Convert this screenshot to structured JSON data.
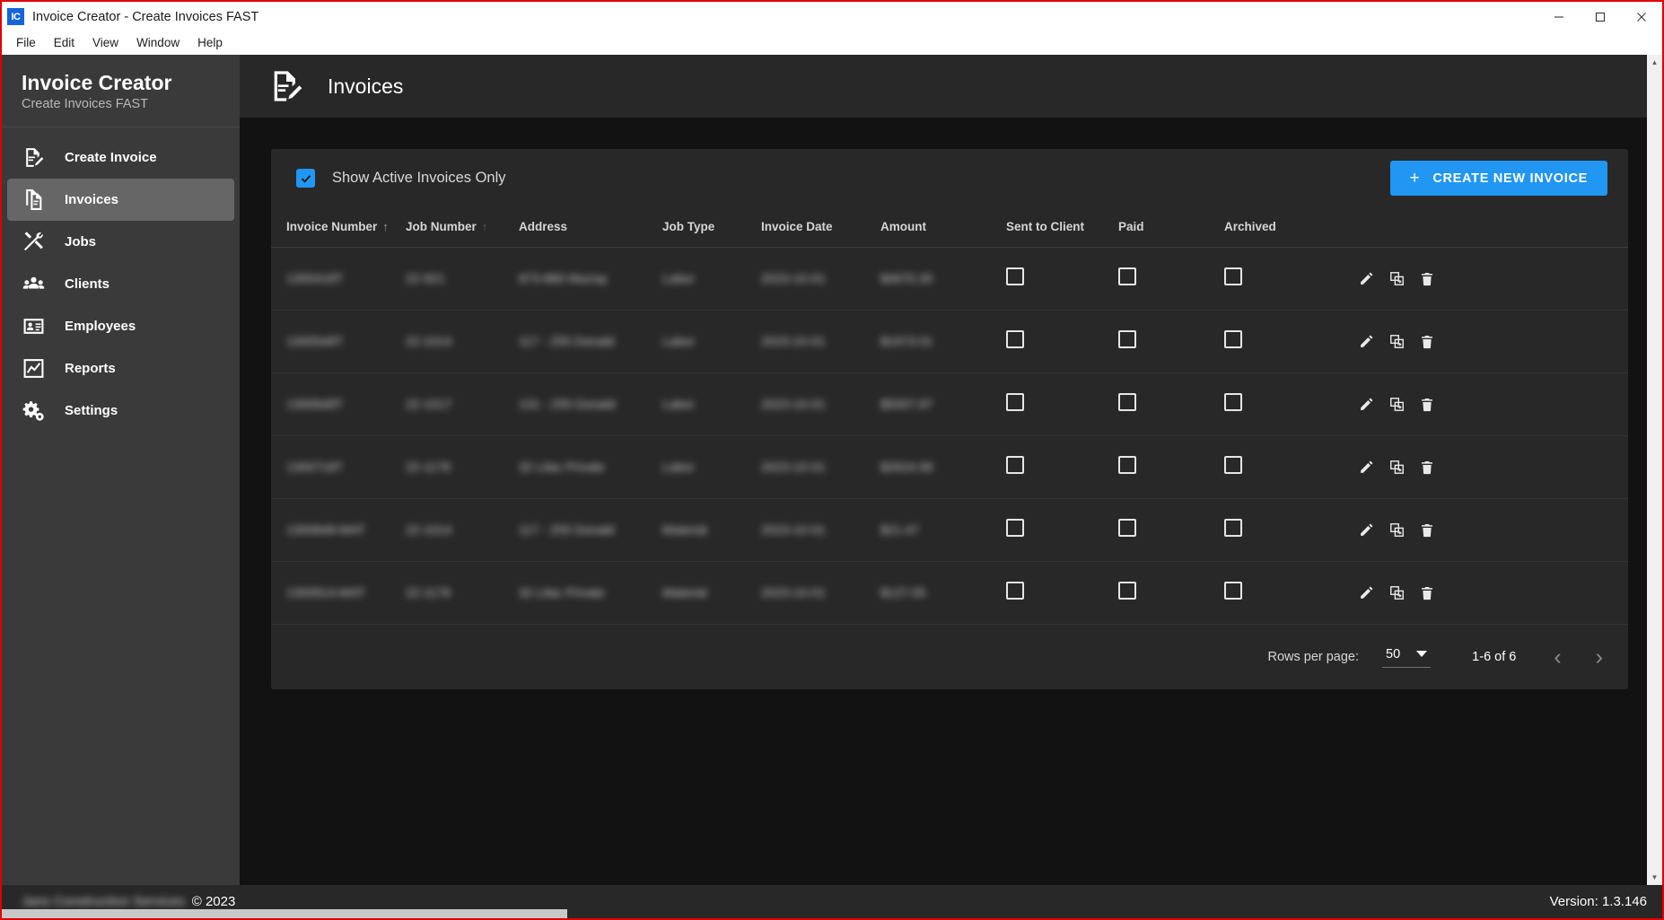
{
  "window": {
    "logo_text": "IC",
    "title": "Invoice Creator - Create Invoices FAST",
    "minimize_label": "—",
    "maximize_label": "□",
    "close_label": "✕"
  },
  "menubar": {
    "items": [
      "File",
      "Edit",
      "View",
      "Window",
      "Help"
    ]
  },
  "sidebar": {
    "brand_title": "Invoice Creator",
    "brand_subtitle": "Create Invoices FAST",
    "items": [
      {
        "label": "Create Invoice",
        "icon": "document-edit-icon",
        "active": false
      },
      {
        "label": "Invoices",
        "icon": "documents-icon",
        "active": true
      },
      {
        "label": "Jobs",
        "icon": "tools-icon",
        "active": false
      },
      {
        "label": "Clients",
        "icon": "people-icon",
        "active": false
      },
      {
        "label": "Employees",
        "icon": "id-card-icon",
        "active": false
      },
      {
        "label": "Reports",
        "icon": "chart-line-icon",
        "active": false
      },
      {
        "label": "Settings",
        "icon": "gears-icon",
        "active": false
      }
    ]
  },
  "page": {
    "icon": "document-edit-icon",
    "title": "Invoices"
  },
  "toolbar": {
    "filter_checkbox_label": "Show Active Invoices Only",
    "filter_checkbox_checked": true,
    "create_button_label": "CREATE NEW INVOICE",
    "create_button_plus": "+",
    "accent_color": "#2196f3"
  },
  "table": {
    "columns": [
      {
        "label": "Invoice Number",
        "sort": "asc",
        "sort_active": true
      },
      {
        "label": "Job Number",
        "sort": "asc",
        "sort_active": false
      },
      {
        "label": "Address",
        "sort": null,
        "sort_active": false
      },
      {
        "label": "Job Type",
        "sort": null,
        "sort_active": false
      },
      {
        "label": "Invoice Date",
        "sort": null,
        "sort_active": false
      },
      {
        "label": "Amount",
        "sort": null,
        "sort_active": false
      },
      {
        "label": "Sent to Client",
        "sort": null,
        "sort_active": false
      },
      {
        "label": "Paid",
        "sort": null,
        "sort_active": false
      },
      {
        "label": "Archived",
        "sort": null,
        "sort_active": false
      },
      {
        "label": "",
        "sort": null,
        "sort_active": false
      }
    ],
    "sort_asc_glyph": "↑",
    "rows": [
      {
        "invoice_number": "1300418T",
        "job_number": "22-921",
        "address": "873-880 Murray",
        "job_type": "Labor",
        "invoice_date": "2023-10-01",
        "amount": "$4670.30",
        "sent_to_client": false,
        "paid": false,
        "archived": false
      },
      {
        "invoice_number": "1300548T",
        "job_number": "22-1014",
        "address": "117 - 255 Donald",
        "job_type": "Labor",
        "invoice_date": "2023-10-01",
        "amount": "$1973.01",
        "sent_to_client": false,
        "paid": false,
        "archived": false
      },
      {
        "invoice_number": "1300648T",
        "job_number": "22-1017",
        "address": "131 - 255 Donald",
        "job_type": "Labor",
        "invoice_date": "2023-10-01",
        "amount": "$5007.87",
        "sent_to_client": false,
        "paid": false,
        "archived": false
      },
      {
        "invoice_number": "1300718T",
        "job_number": "22-1176",
        "address": "32 Lilac Private",
        "job_type": "Labor",
        "invoice_date": "2023-10-01",
        "amount": "$2624.99",
        "sent_to_client": false,
        "paid": false,
        "archived": false
      },
      {
        "invoice_number": "1300848-MAT",
        "job_number": "22-1014",
        "address": "117 - 255 Donald",
        "job_type": "Material",
        "invoice_date": "2023-10-01",
        "amount": "$21.47",
        "sent_to_client": false,
        "paid": false,
        "archived": false
      },
      {
        "invoice_number": "1300914-MAT",
        "job_number": "22-1176",
        "address": "32 Lilac Private",
        "job_type": "Material",
        "invoice_date": "2023-10-01",
        "amount": "$127.05",
        "sent_to_client": false,
        "paid": false,
        "archived": false
      }
    ],
    "row_actions": [
      {
        "name": "edit",
        "icon": "pencil-icon"
      },
      {
        "name": "duplicate",
        "icon": "copy-icon"
      },
      {
        "name": "delete",
        "icon": "trash-icon"
      }
    ]
  },
  "pagination": {
    "rows_per_page_label": "Rows per page:",
    "rows_per_page_value": "50",
    "range_label": "1-6 of 6",
    "prev_glyph": "‹",
    "next_glyph": "›"
  },
  "statusbar": {
    "company": "Jans Construction Services",
    "copyright": "© 2023",
    "version": "Version: 1.3.146"
  }
}
